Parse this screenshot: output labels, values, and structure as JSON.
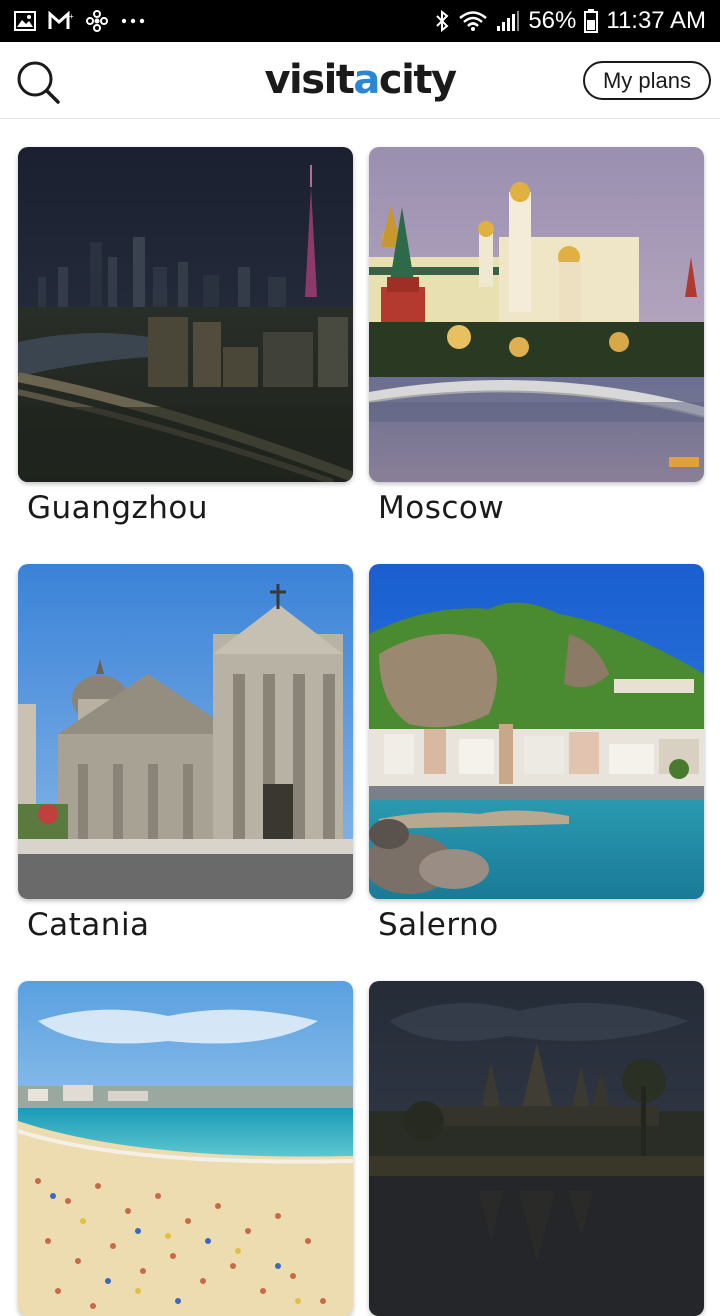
{
  "status_bar": {
    "battery_percent": "56%",
    "time": "11:37 AM",
    "left_icons": [
      "gallery-icon",
      "gmail-icon",
      "fan-icon",
      "more-dots-icon"
    ],
    "right_icons": [
      "bluetooth-icon",
      "wifi-icon",
      "signal-icon",
      "battery-icon"
    ]
  },
  "header": {
    "logo_prefix": "visit",
    "logo_accent": "a",
    "logo_suffix": "city",
    "my_plans_label": "My plans",
    "search_icon": "search-icon",
    "accent_color": "#2b86d6"
  },
  "cities": [
    {
      "name": "Guangzhou"
    },
    {
      "name": "Moscow"
    },
    {
      "name": "Catania"
    },
    {
      "name": "Salerno"
    },
    {
      "name": ""
    },
    {
      "name": ""
    }
  ]
}
